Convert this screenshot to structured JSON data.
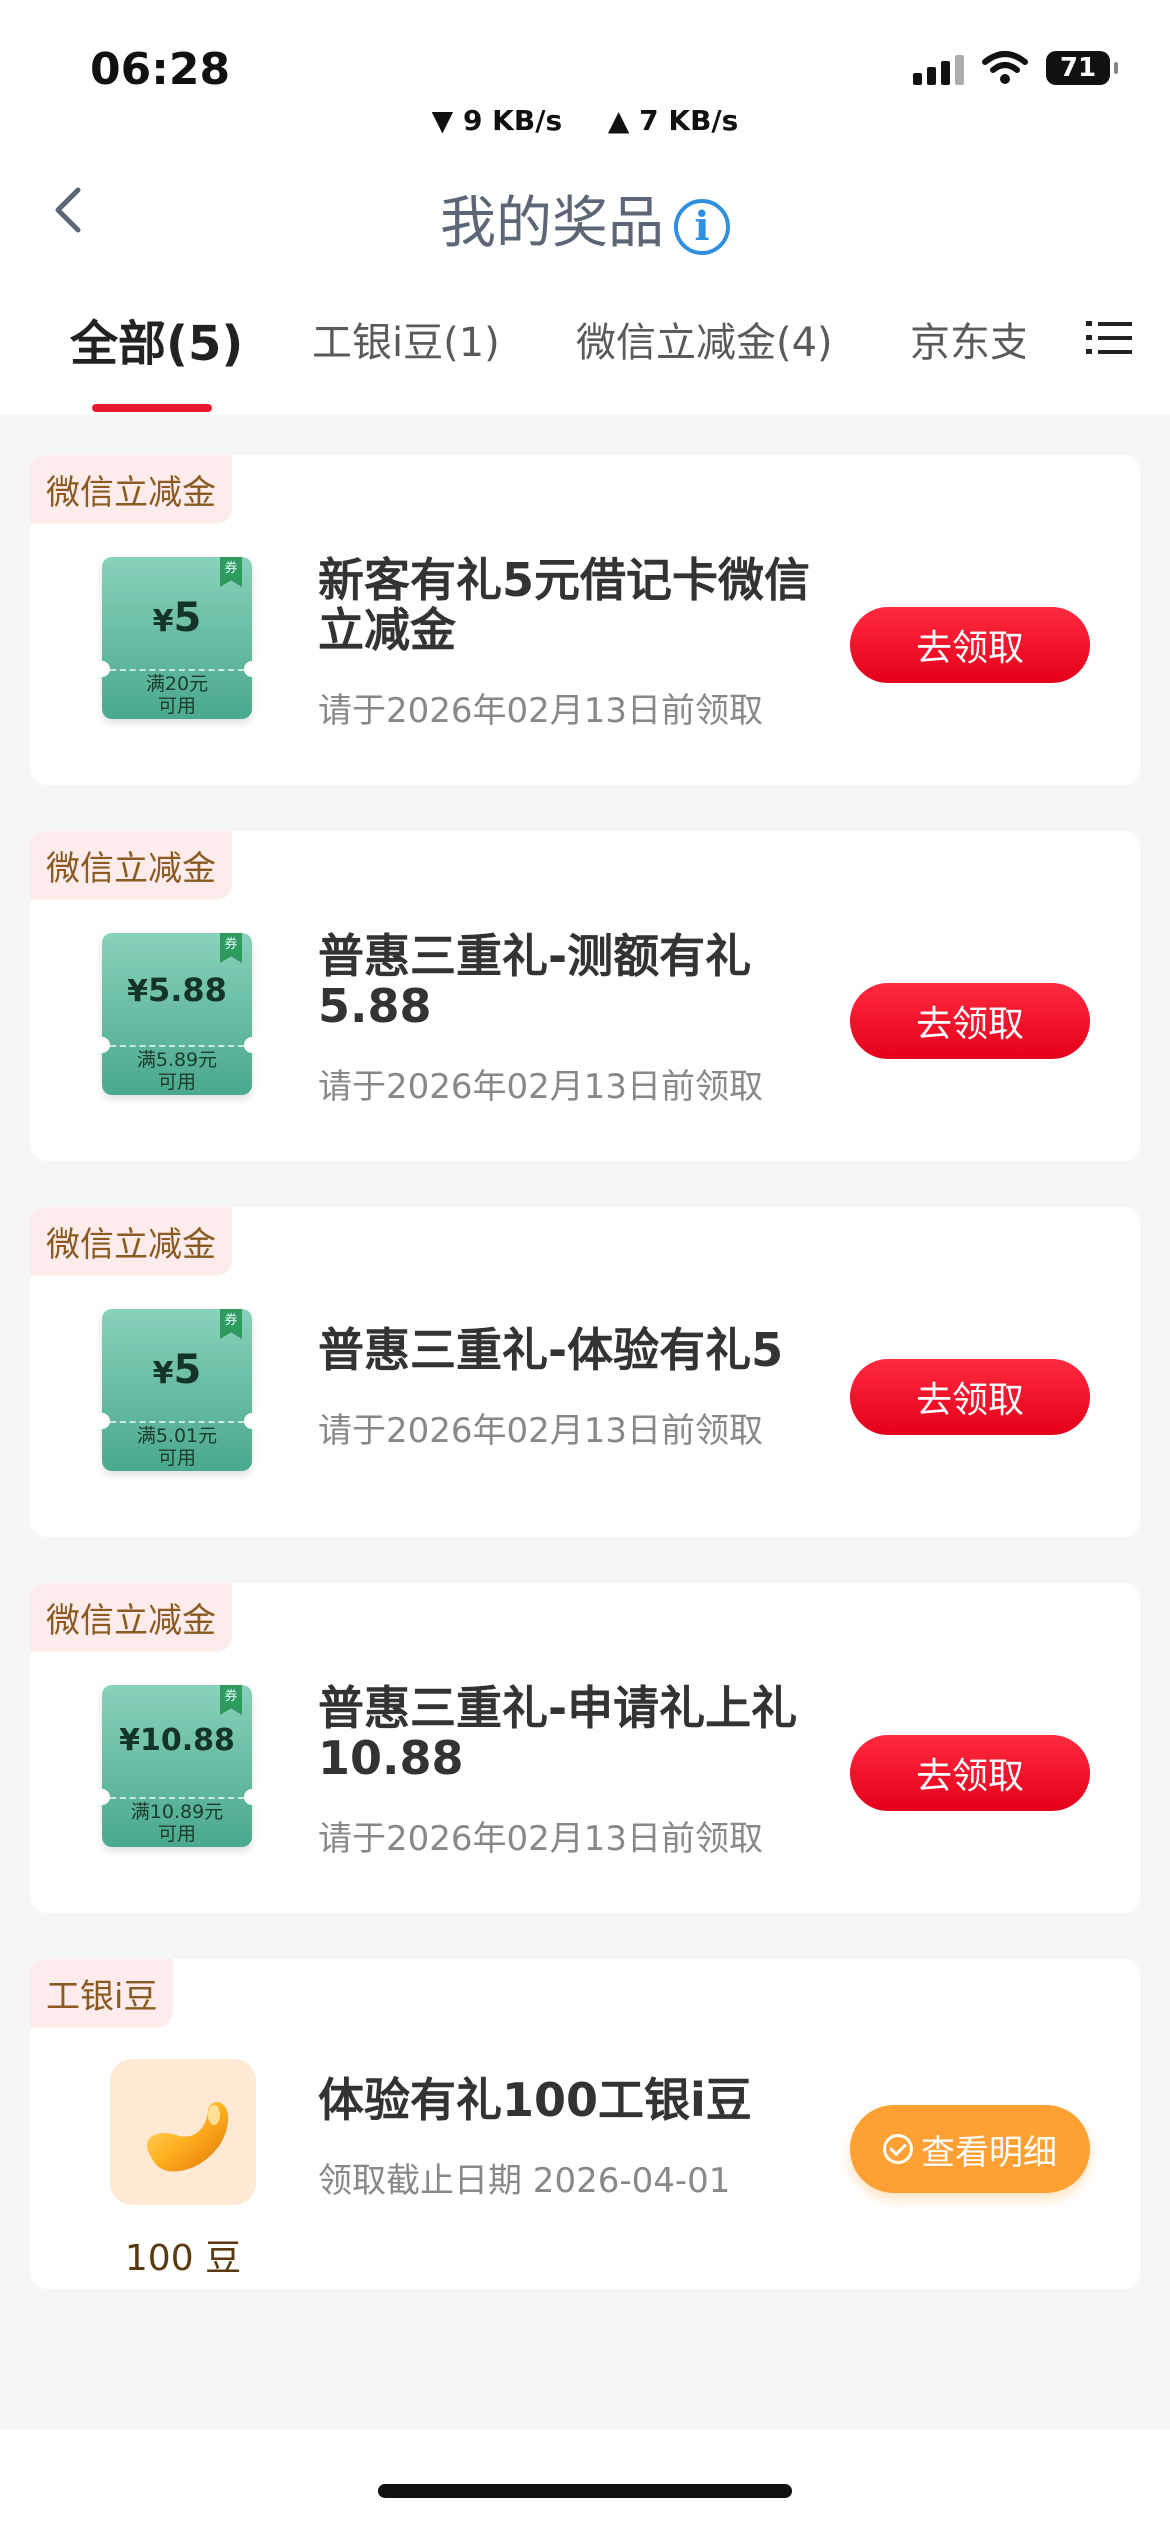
{
  "status_bar": {
    "time": "06:28",
    "download_speed": "▼ 9 KB/s",
    "upload_speed": "▲ 7 KB/s",
    "battery": "71"
  },
  "nav": {
    "title": "我的奖品",
    "info_glyph": "i"
  },
  "tabs": [
    {
      "label": "全部(5)"
    },
    {
      "label": "工银i豆(1)"
    },
    {
      "label": "微信立减金(4)"
    },
    {
      "label": "京东支"
    }
  ],
  "items": [
    {
      "tag": "微信立减金",
      "coupon_symbol": "¥",
      "coupon_amount": "5",
      "coupon_cond_1": "满20元",
      "coupon_cond_2": "可用",
      "coupon_badge": "券",
      "title": "新客有礼5元借记卡微信立减金",
      "subtitle": "请于2026年02月13日前领取",
      "button": "去领取"
    },
    {
      "tag": "微信立减金",
      "coupon_symbol": "¥",
      "coupon_amount": "5.88",
      "coupon_cond_1": "满5.89元",
      "coupon_cond_2": "可用",
      "coupon_badge": "券",
      "title": "普惠三重礼-测额有礼5.88",
      "subtitle": "请于2026年02月13日前领取",
      "button": "去领取"
    },
    {
      "tag": "微信立减金",
      "coupon_symbol": "¥",
      "coupon_amount": "5",
      "coupon_cond_1": "满5.01元",
      "coupon_cond_2": "可用",
      "coupon_badge": "券",
      "title": "普惠三重礼-体验有礼5",
      "subtitle": "请于2026年02月13日前领取",
      "button": "去领取"
    },
    {
      "tag": "微信立减金",
      "coupon_symbol": "¥",
      "coupon_amount": "10.88",
      "coupon_cond_1": "满10.89元",
      "coupon_cond_2": "可用",
      "coupon_badge": "券",
      "title": "普惠三重礼-申请礼上礼10.88",
      "subtitle": "请于2026年02月13日前领取",
      "button": "去领取"
    }
  ],
  "bean_item": {
    "tag": "工银i豆",
    "count": "100 豆",
    "title": "体验有礼100工银i豆",
    "subtitle": "领取截止日期 2026-04-01",
    "button": "查看明细"
  },
  "colors": {
    "accent_red": "#e8192c",
    "detail_orange": "#ffa033",
    "coupon_green": "#4aa98c"
  }
}
